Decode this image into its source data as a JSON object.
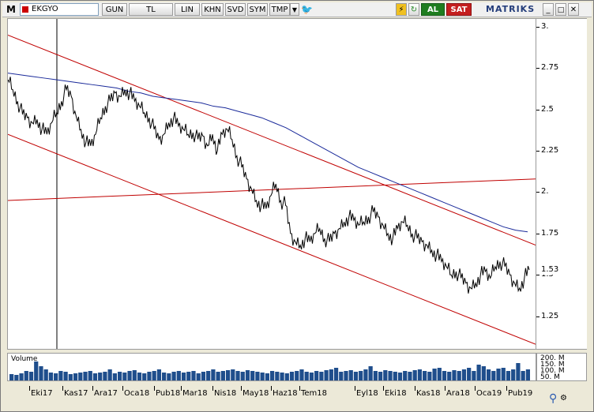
{
  "toolbar": {
    "m_label": "M",
    "symbol": "EKGYO",
    "buttons": [
      "GUN",
      "TL",
      "LIN",
      "KHN",
      "SVD",
      "SYM",
      "TMP"
    ],
    "al_label": "AL",
    "sat_label": "SAT",
    "logo": "MATRIKS"
  },
  "chart": {
    "y_axis_labels": [
      "3.",
      "2.75",
      "2.5",
      "2.25",
      "2.",
      "1.75",
      "1.5",
      "1.25"
    ],
    "last_price": "1.53",
    "x_axis_labels": [
      "Eki17",
      "Kas17",
      "Ara17",
      "Oca18",
      "Pub18",
      "Mar18",
      "Nis18",
      "May18",
      "Haz18",
      "Tem18",
      "Eyl18",
      "Eki18",
      "Kas18",
      "Ara18",
      "Oca19",
      "Pub19"
    ],
    "line_color": "#000000",
    "ma_color": "#1a2a9a",
    "trend_color": "#c00000"
  },
  "volume": {
    "title": "Volume",
    "labels": [
      "200. M",
      "150. M",
      "100. M",
      "50. M"
    ],
    "bar_color": "#1f4e8c"
  },
  "chart_data": {
    "type": "line",
    "ylim": [
      1.1,
      3.0
    ],
    "close": [
      2.68,
      2.62,
      2.55,
      2.47,
      2.45,
      2.42,
      2.44,
      2.38,
      2.35,
      2.42,
      2.48,
      2.55,
      2.62,
      2.58,
      2.46,
      2.38,
      2.3,
      2.28,
      2.35,
      2.45,
      2.52,
      2.55,
      2.6,
      2.58,
      2.62,
      2.6,
      2.55,
      2.52,
      2.48,
      2.45,
      2.38,
      2.32,
      2.35,
      2.42,
      2.45,
      2.4,
      2.38,
      2.35,
      2.36,
      2.32,
      2.34,
      2.28,
      2.35,
      2.25,
      2.35,
      2.38,
      2.32,
      2.22,
      2.15,
      2.08,
      2.02,
      1.95,
      1.92,
      1.9,
      1.98,
      2.05,
      1.95,
      1.92,
      1.75,
      1.7,
      1.68,
      1.72,
      1.7,
      1.75,
      1.78,
      1.72,
      1.7,
      1.75,
      1.78,
      1.82,
      1.85,
      1.83,
      1.8,
      1.82,
      1.85,
      1.88,
      1.85,
      1.8,
      1.75,
      1.72,
      1.78,
      1.82,
      1.8,
      1.75,
      1.72,
      1.7,
      1.68,
      1.65,
      1.62,
      1.58,
      1.55,
      1.5,
      1.52,
      1.48,
      1.45,
      1.42,
      1.45,
      1.5,
      1.52,
      1.48,
      1.55,
      1.58,
      1.55,
      1.5,
      1.45,
      1.42,
      1.48,
      1.53
    ],
    "ma": [
      2.72,
      2.71,
      2.7,
      2.69,
      2.68,
      2.67,
      2.66,
      2.65,
      2.64,
      2.63,
      2.61,
      2.6,
      2.58,
      2.57,
      2.56,
      2.55,
      2.54,
      2.52,
      2.51,
      2.49,
      2.47,
      2.45,
      2.42,
      2.39,
      2.35,
      2.31,
      2.27,
      2.23,
      2.19,
      2.15,
      2.12,
      2.09,
      2.06,
      2.03,
      2.0,
      1.97,
      1.94,
      1.91,
      1.88,
      1.85,
      1.82,
      1.79,
      1.77,
      1.76
    ],
    "trend_lines": [
      {
        "from": [
          0,
          2.95
        ],
        "to": [
          1,
          1.68
        ]
      },
      {
        "from": [
          0,
          2.35
        ],
        "to": [
          1,
          1.08
        ]
      },
      {
        "from": [
          0,
          1.95
        ],
        "to": [
          1,
          2.08
        ]
      }
    ],
    "volume": [
      40,
      35,
      45,
      60,
      55,
      120,
      90,
      70,
      50,
      45,
      60,
      55,
      40,
      45,
      50,
      55,
      60,
      45,
      50,
      55,
      70,
      45,
      55,
      50,
      60,
      65,
      50,
      45,
      55,
      60,
      70,
      50,
      45,
      55,
      60,
      50,
      55,
      60,
      45,
      55,
      60,
      70,
      55,
      60,
      65,
      70,
      60,
      55,
      65,
      60,
      55,
      50,
      45,
      60,
      55,
      50,
      45,
      55,
      60,
      70,
      55,
      50,
      60,
      55,
      65,
      70,
      80,
      55,
      60,
      65,
      55,
      60,
      70,
      90,
      60,
      55,
      65,
      60,
      55,
      50,
      60,
      55,
      65,
      70,
      60,
      55,
      75,
      80,
      60,
      55,
      65,
      60,
      70,
      80,
      60,
      100,
      90,
      70,
      60,
      75,
      80,
      60,
      70,
      110,
      60,
      70
    ]
  }
}
